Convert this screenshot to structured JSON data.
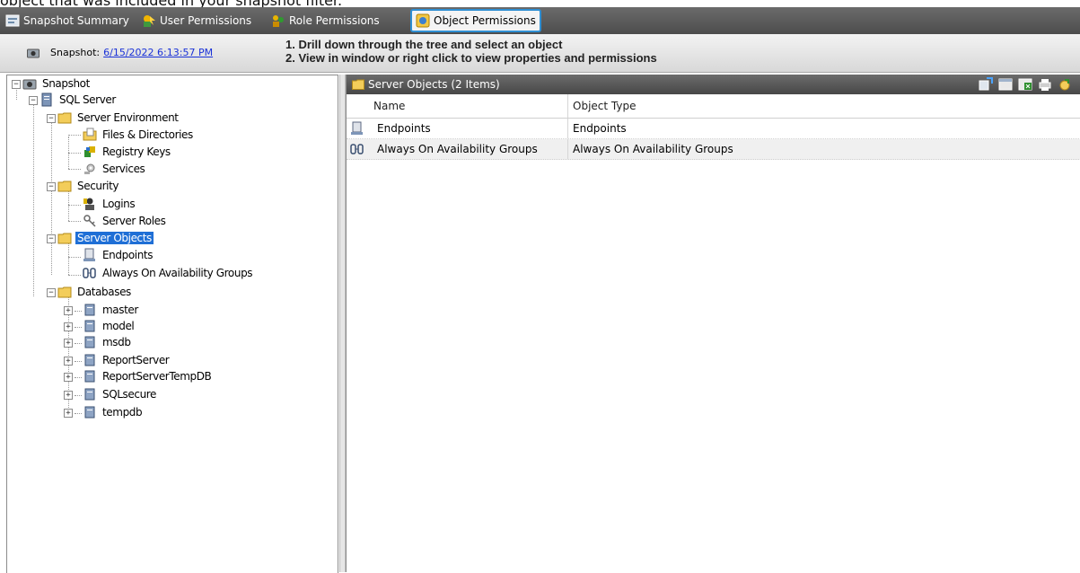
{
  "caption": "object that was included in your snapshot filter.",
  "tabs": [
    {
      "label": "Snapshot Summary",
      "icon": "summary-icon"
    },
    {
      "label": "User Permissions",
      "icon": "user-permissions-icon"
    },
    {
      "label": "Role Permissions",
      "icon": "role-permissions-icon"
    },
    {
      "label": "Object Permissions",
      "icon": "object-permissions-icon",
      "active": true
    }
  ],
  "header": {
    "snapshot_prefix": "Snapshot:",
    "snapshot_link": "6/15/2022 6:13:57 PM",
    "instruction_1": "1. Drill down through the tree and select an object",
    "instruction_2": "2. View in window or right click to view properties and permissions"
  },
  "tree": {
    "snapshot": "Snapshot",
    "sql_server": "SQL Server",
    "server_environment": "Server Environment",
    "files_directories": "Files & Directories",
    "registry_keys": "Registry Keys",
    "services": "Services",
    "security": "Security",
    "logins": "Logins",
    "server_roles": "Server Roles",
    "server_objects": "Server Objects",
    "endpoints": "Endpoints",
    "always_on": "Always On Availability Groups",
    "databases": "Databases",
    "db_list": [
      "master",
      "model",
      "msdb",
      "ReportServer",
      "ReportServerTempDB",
      "SQLsecure",
      "tempdb"
    ]
  },
  "panel": {
    "title": "Server Objects (2 Items)",
    "columns": [
      "Name",
      "Object Type"
    ],
    "rows": [
      {
        "name": "Endpoints",
        "type": "Endpoints"
      },
      {
        "name": "Always On Availability Groups",
        "type": "Always On Availability Groups"
      }
    ]
  },
  "colors": {
    "selection": "#1f6fd6",
    "active_tab_border": "#2f8fd3",
    "link": "#1a32d8"
  }
}
